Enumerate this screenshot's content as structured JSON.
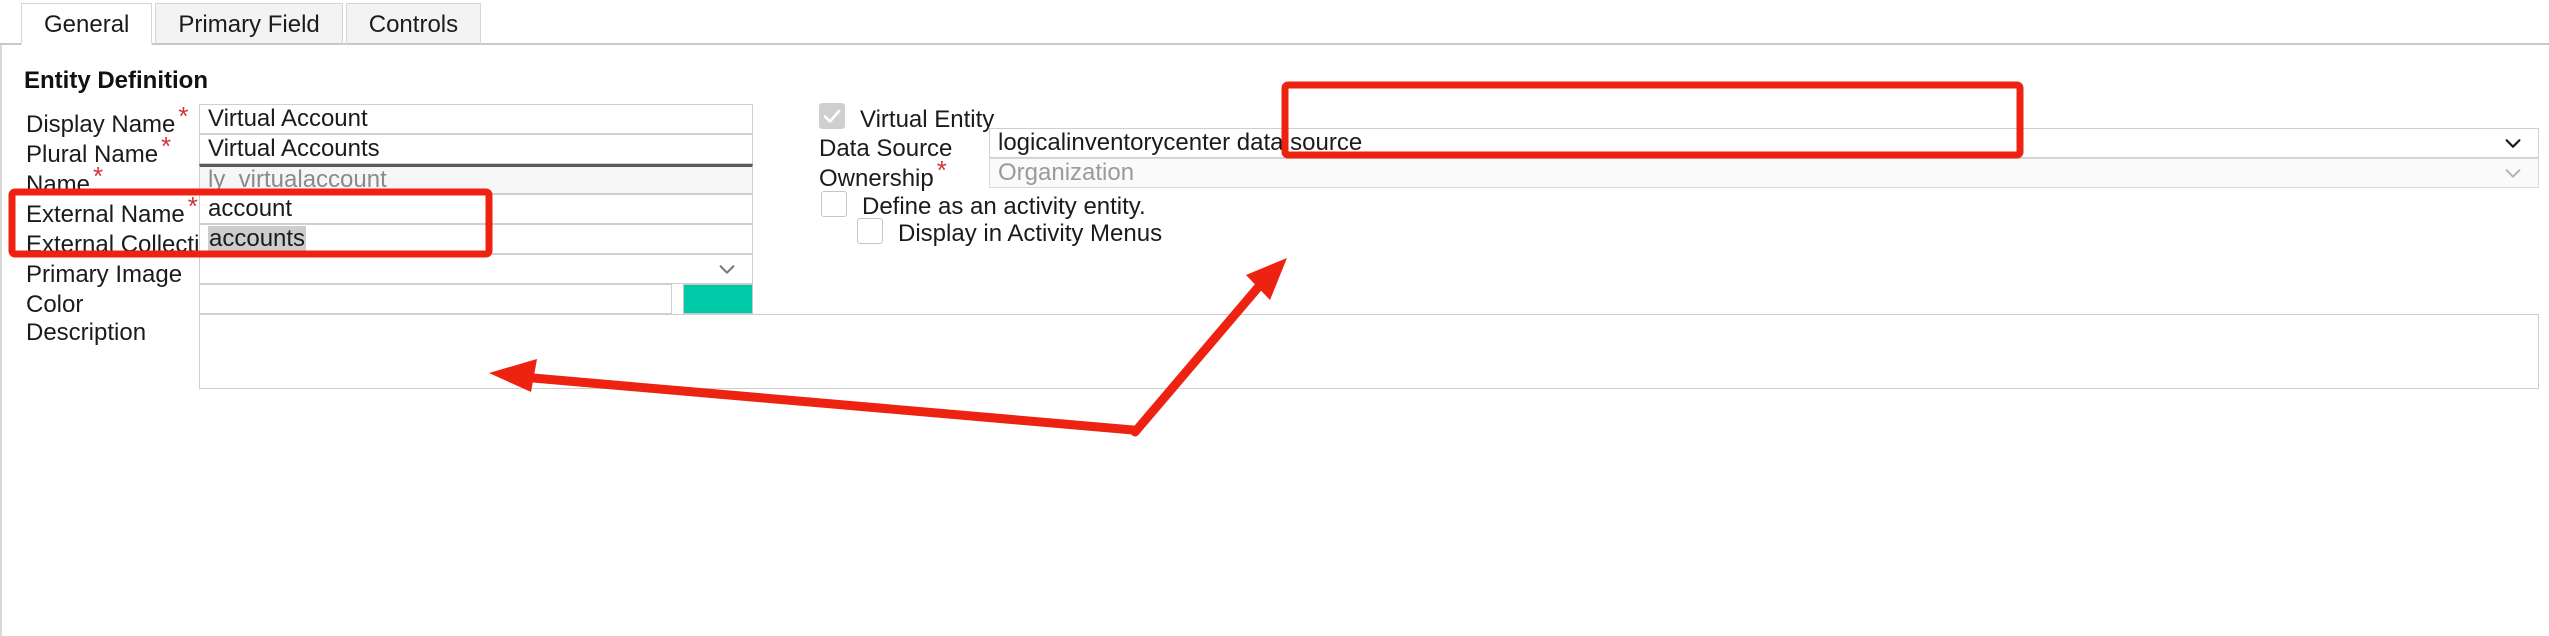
{
  "tabs": [
    {
      "label": "General",
      "active": true
    },
    {
      "label": "Primary Field",
      "active": false
    },
    {
      "label": "Controls",
      "active": false
    }
  ],
  "section": {
    "title": "Entity Definition"
  },
  "left_form": {
    "fields": [
      {
        "label": "Display Name",
        "required": true,
        "value": "Virtual Account"
      },
      {
        "label": "Plural Name",
        "required": true,
        "value": "Virtual Accounts"
      },
      {
        "label": "Name",
        "required": true,
        "value": "ly_virtualaccount"
      },
      {
        "label": "External Name",
        "required": true,
        "value": "account"
      },
      {
        "label": "External Collection Name",
        "required": true,
        "value": "accounts"
      },
      {
        "label": "Primary Image",
        "required": false,
        "value": ""
      },
      {
        "label": "Color",
        "required": false,
        "value": ""
      },
      {
        "label": "Description",
        "required": false,
        "value": ""
      }
    ],
    "color_swatch_hex": "#00C9A7"
  },
  "right_form": {
    "virtual_entity": {
      "label": "Virtual Entity",
      "checked": true,
      "disabled": true
    },
    "data_source": {
      "label": "Data Source",
      "required": false,
      "value": "logicalinventorycenter data source"
    },
    "ownership": {
      "label": "Ownership",
      "required": true,
      "value": "Organization",
      "disabled": true
    },
    "activity_entity": {
      "label": "Define as an activity entity.",
      "checked": false
    },
    "activity_menus": {
      "label": "Display in Activity Menus",
      "checked": false
    }
  },
  "annotations": {
    "highlight_color": "#EE2211",
    "boxes": [
      {
        "name": "external-names-highlight"
      },
      {
        "name": "data-source-highlight"
      }
    ],
    "arrows": [
      {
        "name": "arrow-to-external-collection-name"
      },
      {
        "name": "arrow-to-data-source"
      }
    ]
  }
}
